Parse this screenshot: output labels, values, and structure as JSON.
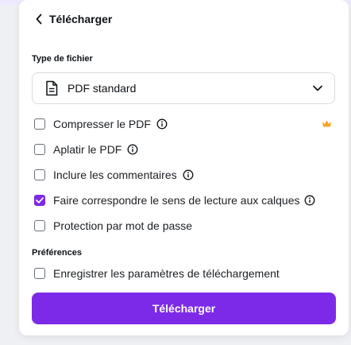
{
  "header": {
    "title": "Télécharger",
    "back_icon": "chevron-left-icon"
  },
  "file_type": {
    "section_label": "Type de fichier",
    "selected_value": "PDF standard",
    "icon": "document-icon",
    "dropdown_icon": "chevron-down-icon"
  },
  "options": [
    {
      "label": "Compresser le PDF",
      "checked": false,
      "info": true,
      "premium": true
    },
    {
      "label": "Aplatir le PDF",
      "checked": false,
      "info": true
    },
    {
      "label": "Inclure les commentaires",
      "checked": false,
      "info": true
    },
    {
      "label": "Faire correspondre le sens de lecture aux calques",
      "checked": true,
      "info": true
    },
    {
      "label": "Protection par mot de passe",
      "checked": false,
      "info": false
    }
  ],
  "preferences": {
    "section_label": "Préférences",
    "save_settings": {
      "label": "Enregistrer les paramètres de téléchargement",
      "checked": false
    }
  },
  "download_button": {
    "label": "Télécharger"
  },
  "colors": {
    "accent": "#7d2ae8",
    "crown": "#f5a623"
  }
}
